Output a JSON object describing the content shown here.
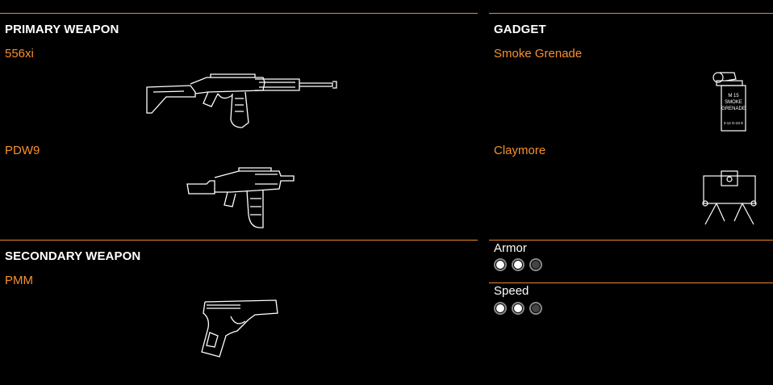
{
  "primary": {
    "heading": "PRIMARY WEAPON",
    "items": [
      {
        "name": "556xi",
        "icon": "assault-rifle-icon"
      },
      {
        "name": "PDW9",
        "icon": "smg-icon"
      }
    ]
  },
  "secondary": {
    "heading": "SECONDARY WEAPON",
    "items": [
      {
        "name": "PMM",
        "icon": "pistol-icon"
      }
    ]
  },
  "gadget": {
    "heading": "GADGET",
    "items": [
      {
        "name": "Smoke Grenade",
        "icon": "smoke-grenade-icon",
        "canister_text": [
          "M 15",
          "SMOKE",
          "GRENADE"
        ],
        "canister_code": "3-12 G-22 E"
      },
      {
        "name": "Claymore",
        "icon": "claymore-icon"
      }
    ]
  },
  "stats": [
    {
      "label": "Armor",
      "value": 2,
      "max": 3
    },
    {
      "label": "Speed",
      "value": 2,
      "max": 3
    }
  ],
  "colors": {
    "accent": "#f7902f",
    "rule": "#e8892b",
    "background": "#000000"
  }
}
